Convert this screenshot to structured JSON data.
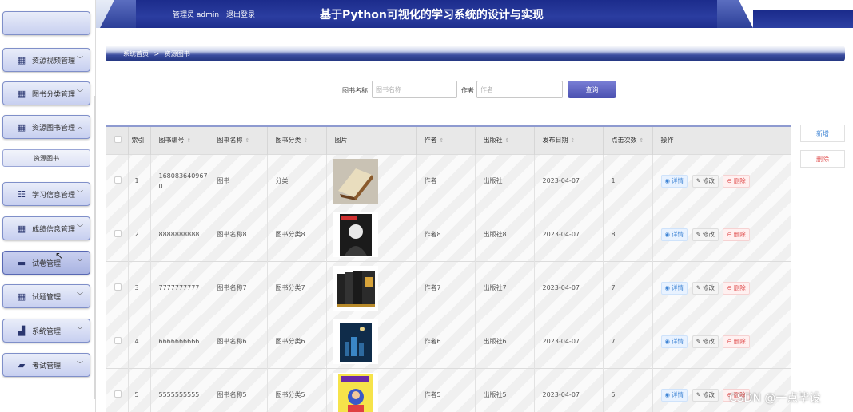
{
  "header": {
    "user_role": "管理员 admin",
    "logout": "退出登录",
    "title": "基于Python可视化的学习系统的设计与实现"
  },
  "sidebar": {
    "items": [
      {
        "label": "资源视频管理",
        "icon": "grid-icon"
      },
      {
        "label": "图书分类管理",
        "icon": "grid-icon"
      },
      {
        "label": "资源图书管理",
        "icon": "grid-icon",
        "expanded": true
      },
      {
        "label": "学习信息管理",
        "icon": "list-icon"
      },
      {
        "label": "成绩信息管理",
        "icon": "grid-icon"
      },
      {
        "label": "试卷管理",
        "icon": "monitor-icon",
        "active": true
      },
      {
        "label": "试题管理",
        "icon": "grid-icon"
      },
      {
        "label": "系统管理",
        "icon": "chart-icon"
      },
      {
        "label": "考试管理",
        "icon": "card-icon"
      }
    ],
    "sub_item": "资源图书"
  },
  "breadcrumb": {
    "home": "系统首页",
    "separator": ">",
    "current": "资源图书"
  },
  "search": {
    "name_label": "图书名称",
    "name_placeholder": "图书名称",
    "author_label": "作者",
    "author_placeholder": "作者",
    "button": "查询"
  },
  "actions": {
    "add": "新增",
    "delete": "删除"
  },
  "table": {
    "columns": [
      "索引",
      "图书编号",
      "图书名称",
      "图书分类",
      "图片",
      "作者",
      "出版社",
      "发布日期",
      "点击次数",
      "操作"
    ],
    "op_labels": {
      "view": "详情",
      "edit": "修改",
      "delete": "删除"
    },
    "rows": [
      {
        "idx": "1",
        "code": "1680836409670",
        "name": "图书",
        "category": "分类",
        "author": "作者",
        "publisher": "出版社",
        "date": "2023-04-07",
        "clicks": "1",
        "cover": "open-book-cover"
      },
      {
        "idx": "2",
        "code": "8888888888",
        "name": "图书名称8",
        "category": "图书分类8",
        "author": "作者8",
        "publisher": "出版社8",
        "date": "2023-04-07",
        "clicks": "8",
        "cover": "portrait-cover"
      },
      {
        "idx": "3",
        "code": "7777777777",
        "name": "图书名称7",
        "category": "图书分类7",
        "author": "作者7",
        "publisher": "出版社7",
        "date": "2023-04-07",
        "clicks": "7",
        "cover": "box-set-cover"
      },
      {
        "idx": "4",
        "code": "6666666666",
        "name": "图书名称6",
        "category": "图书分类6",
        "author": "作者6",
        "publisher": "出版社6",
        "date": "2023-04-07",
        "clicks": "7",
        "cover": "night-city-cover"
      },
      {
        "idx": "5",
        "code": "5555555555",
        "name": "图书名称5",
        "category": "图书分类5",
        "author": "作者5",
        "publisher": "出版社5",
        "date": "2023-04-07",
        "clicks": "5",
        "cover": "comic-cover"
      }
    ]
  },
  "watermark": "CSDN @一点毕设",
  "colors": {
    "primary": "#2b3da0",
    "button": "#5a60c0",
    "view": "#3c83d4",
    "delete": "#e05050"
  }
}
